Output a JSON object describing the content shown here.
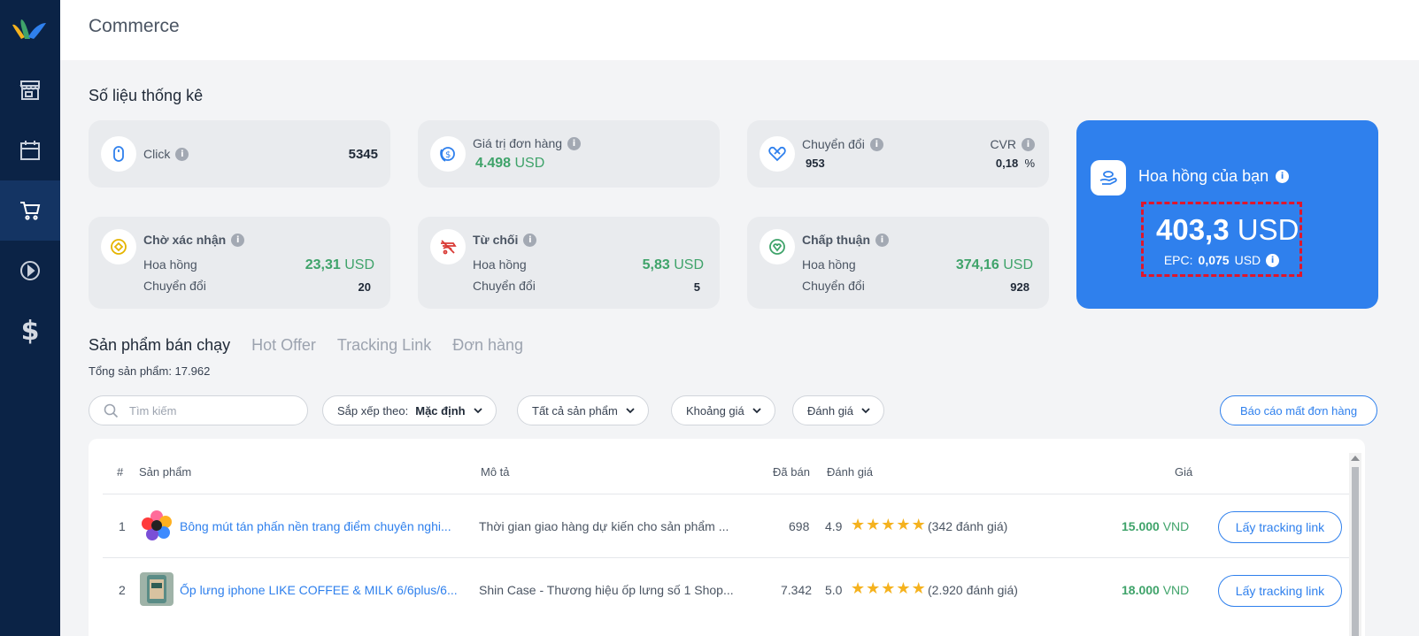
{
  "app": {
    "title": "Commerce"
  },
  "sidebar": {
    "items": [
      {
        "name": "store-icon"
      },
      {
        "name": "calendar-icon"
      },
      {
        "name": "cart-icon",
        "active": true
      },
      {
        "name": "play-icon"
      },
      {
        "name": "dollar-icon",
        "glyph": "$"
      }
    ]
  },
  "stats": {
    "title": "Số liệu thống kê",
    "click": {
      "label": "Click",
      "value": "5345"
    },
    "order_value": {
      "label": "Giá trị đơn hàng",
      "value": "4.498",
      "unit": "USD"
    },
    "conversion": {
      "label": "Chuyển đổi",
      "value": "953",
      "cvr_label": "CVR",
      "cvr_value": "0,18",
      "cvr_unit": "%"
    },
    "pending": {
      "label": "Chờ xác nhận",
      "commission_label": "Hoa hồng",
      "commission_value": "23,31",
      "unit": "USD",
      "conv_label": "Chuyển đổi",
      "conv_value": "20"
    },
    "rejected": {
      "label": "Từ chối",
      "commission_label": "Hoa hồng",
      "commission_value": "5,83",
      "unit": "USD",
      "conv_label": "Chuyển đổi",
      "conv_value": "5"
    },
    "approved": {
      "label": "Chấp thuận",
      "commission_label": "Hoa hồng",
      "commission_value": "374,16",
      "unit": "USD",
      "conv_label": "Chuyển đổi",
      "conv_value": "928"
    },
    "commission": {
      "title": "Hoa hồng của bạn",
      "amount": "403,3",
      "unit": "USD",
      "epc_label": "EPC:",
      "epc_value": "0,075",
      "epc_unit": "USD"
    }
  },
  "tabs": [
    "Sản phẩm bán chạy",
    "Hot Offer",
    "Tracking Link",
    "Đơn hàng"
  ],
  "total_label": "Tổng sản phẩm: 17.962",
  "filters": {
    "search_placeholder": "Tìm kiếm",
    "sort_label": "Sắp xếp theo:",
    "sort_value": "Mặc định",
    "category": "Tất cả sản phẩm",
    "price_range": "Khoảng giá",
    "rating": "Đánh giá",
    "report_button": "Báo cáo mất đơn hàng"
  },
  "table": {
    "headers": {
      "index": "#",
      "product": "Sản phẩm",
      "description": "Mô tả",
      "sold": "Đã bán",
      "rating": "Đánh giá",
      "price": "Giá"
    },
    "rows": [
      {
        "index": "1",
        "product": "Bông mút tán phấn nền trang điểm chuyên nghi...",
        "description": "Thời gian giao hàng dự kiến cho sản phẩm ...",
        "sold": "698",
        "rating": "4.9",
        "stars": 5,
        "reviews": "(342 đánh giá)",
        "price": "15.000",
        "currency": "VND",
        "button": "Lấy tracking link"
      },
      {
        "index": "2",
        "product": "Ốp lưng iphone LIKE COFFEE & MILK 6/6plus/6...",
        "description": "Shin Case - Thương hiệu ốp lưng số 1 Shop...",
        "sold": "7.342",
        "rating": "5.0",
        "stars": 5,
        "reviews": "(2.920 đánh giá)",
        "price": "18.000",
        "currency": "VND",
        "button": "Lấy tracking link"
      }
    ]
  },
  "colors": {
    "sidebar": "#0b2346",
    "accent": "#2f80ed",
    "green": "#3fa36a",
    "highlight_border": "#e0162b"
  }
}
